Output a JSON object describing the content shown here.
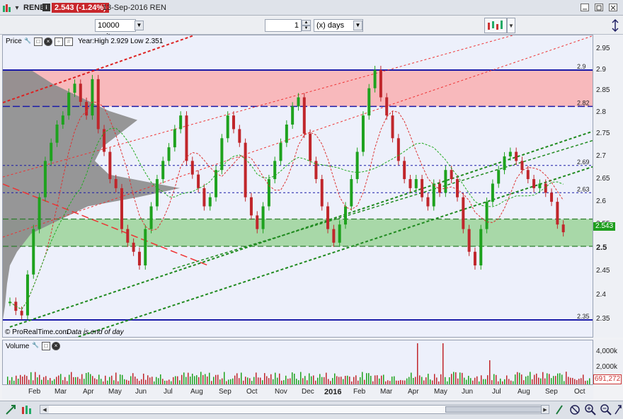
{
  "topbar": {
    "symbol": "RENE",
    "price_change": "2.543 (-1.24%)",
    "date": "13-Sep-2016 REN"
  },
  "toolbar": {
    "units_value": "10000 units",
    "period_value": "1",
    "period_unit": "(x) days"
  },
  "price_panel": {
    "title": "Price",
    "info": "Year:High 2.929 Low 2.351",
    "footer_brand": "© ProRealTime.com",
    "footer_note": "Data is end of day"
  },
  "price_axis": {
    "ticks": [
      "2.95",
      "2.9",
      "2.85",
      "2.8",
      "2.75",
      "2.7",
      "2.65",
      "2.6",
      "2.55",
      "2.5",
      "2.45",
      "2.4",
      "2.35"
    ],
    "levels": [
      "2.9",
      "2.82",
      "2.69",
      "2.63",
      "2.35"
    ],
    "last_price": "2.543"
  },
  "volume_panel": {
    "title": "Volume",
    "ticks": [
      "4,000k",
      "2,000k"
    ],
    "last_volume": "691,272"
  },
  "time_axis": {
    "labels": [
      "Feb",
      "Mar",
      "Apr",
      "May",
      "Jun",
      "Jul",
      "Aug",
      "Sep",
      "Oct",
      "Nov",
      "Dec",
      "2016",
      "Feb",
      "Mar",
      "Apr",
      "May",
      "Jun",
      "Jul",
      "Aug",
      "Sep",
      "Oct"
    ]
  },
  "colors": {
    "up": "#1ea21e",
    "down": "#c0262b",
    "resistance_zone": "#f8b9bc",
    "support_zone": "#a8d8a8",
    "level_line": "#1a1aa8"
  }
}
